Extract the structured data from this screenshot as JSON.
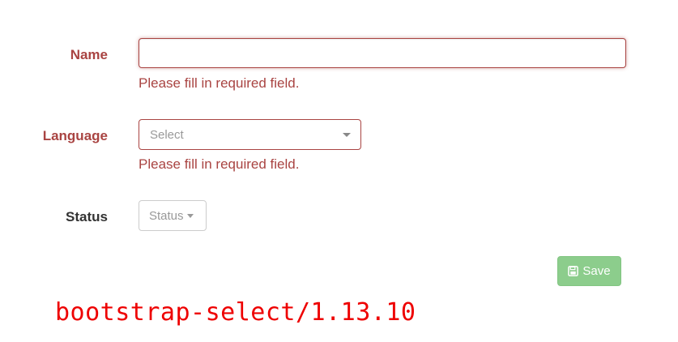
{
  "form": {
    "name": {
      "label": "Name",
      "value": "",
      "help": "Please fill in required field."
    },
    "language": {
      "label": "Language",
      "placeholder": "Select",
      "help": "Please fill in required field."
    },
    "status": {
      "label": "Status",
      "placeholder": "Status"
    },
    "save_label": "Save"
  },
  "footer": {
    "version_text": "bootstrap-select/1.13.10"
  },
  "colors": {
    "error": "#a94442",
    "save_disabled": "#8ccd8c",
    "version": "#ee0000"
  },
  "icons": {
    "save": "floppy-disk-icon",
    "dropdown": "caret-down-icon"
  }
}
